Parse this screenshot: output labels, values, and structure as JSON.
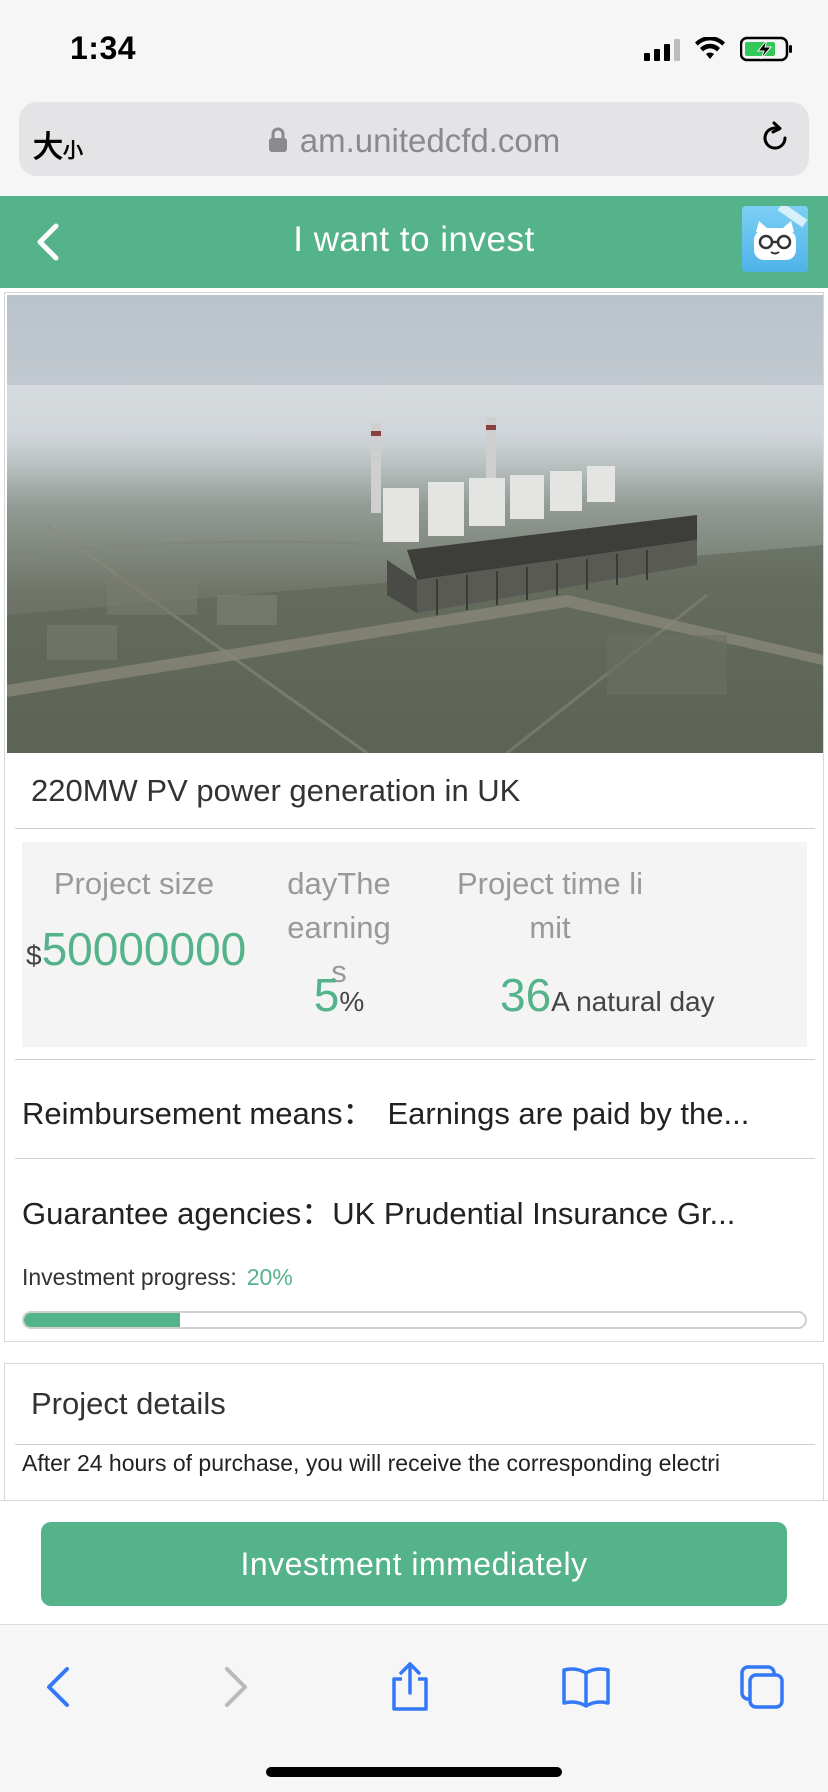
{
  "status_bar": {
    "time": "1:34"
  },
  "browser": {
    "text_size_big": "大",
    "text_size_small": "小",
    "url": "am.unitedcfd.com"
  },
  "header": {
    "title": "I want to invest"
  },
  "project": {
    "title": "220MW PV power generation in UK",
    "stats": {
      "size_label": "Project size",
      "size_currency": "$",
      "size_value": "50000000",
      "earnings_label_1": "dayThe earning",
      "earnings_label_2": "s",
      "earnings_value": "5",
      "earnings_unit": "%",
      "time_label_1": "Project time li",
      "time_label_2": "mit",
      "time_value": "36",
      "time_unit": "A natural day"
    },
    "reimbursement_label": "Reimbursement means：",
    "reimbursement_value": "Earnings are paid by the...",
    "guarantee_label": "Guarantee agencies：",
    "guarantee_value": "UK Prudential Insurance Gr...",
    "progress_label": "Investment progress:",
    "progress_text": "20%",
    "progress_fraction": 0.2
  },
  "details": {
    "title": "Project details",
    "text": "After 24 hours of purchase, you will receive the corresponding electri"
  },
  "action": {
    "invest_label": "Investment immediately"
  },
  "colors": {
    "accent": "#55b38b",
    "ios_blue": "#3478f6"
  }
}
